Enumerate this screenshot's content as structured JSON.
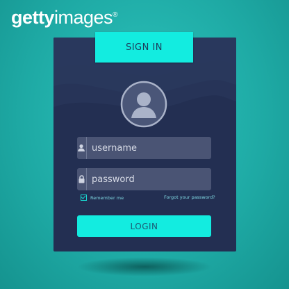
{
  "watermark": {
    "brand": "getty",
    "brand2": "images"
  },
  "form": {
    "tab_label": "SIGN IN",
    "username": {
      "value": "",
      "placeholder": "username"
    },
    "password": {
      "value": "",
      "placeholder": "password"
    },
    "remember_label": "Remember me",
    "remember_checked": true,
    "forgot_label": "Forgot your password?",
    "login_label": "LOGIN"
  },
  "colors": {
    "background": "#1ea9a4",
    "card": "#232f52",
    "accent": "#13ece0",
    "field": "#4a5474",
    "link": "#7fd6e0"
  },
  "icons": {
    "avatar": "user-avatar-icon",
    "username": "user-icon",
    "password": "lock-icon",
    "remember": "checkbox-checked-icon"
  }
}
